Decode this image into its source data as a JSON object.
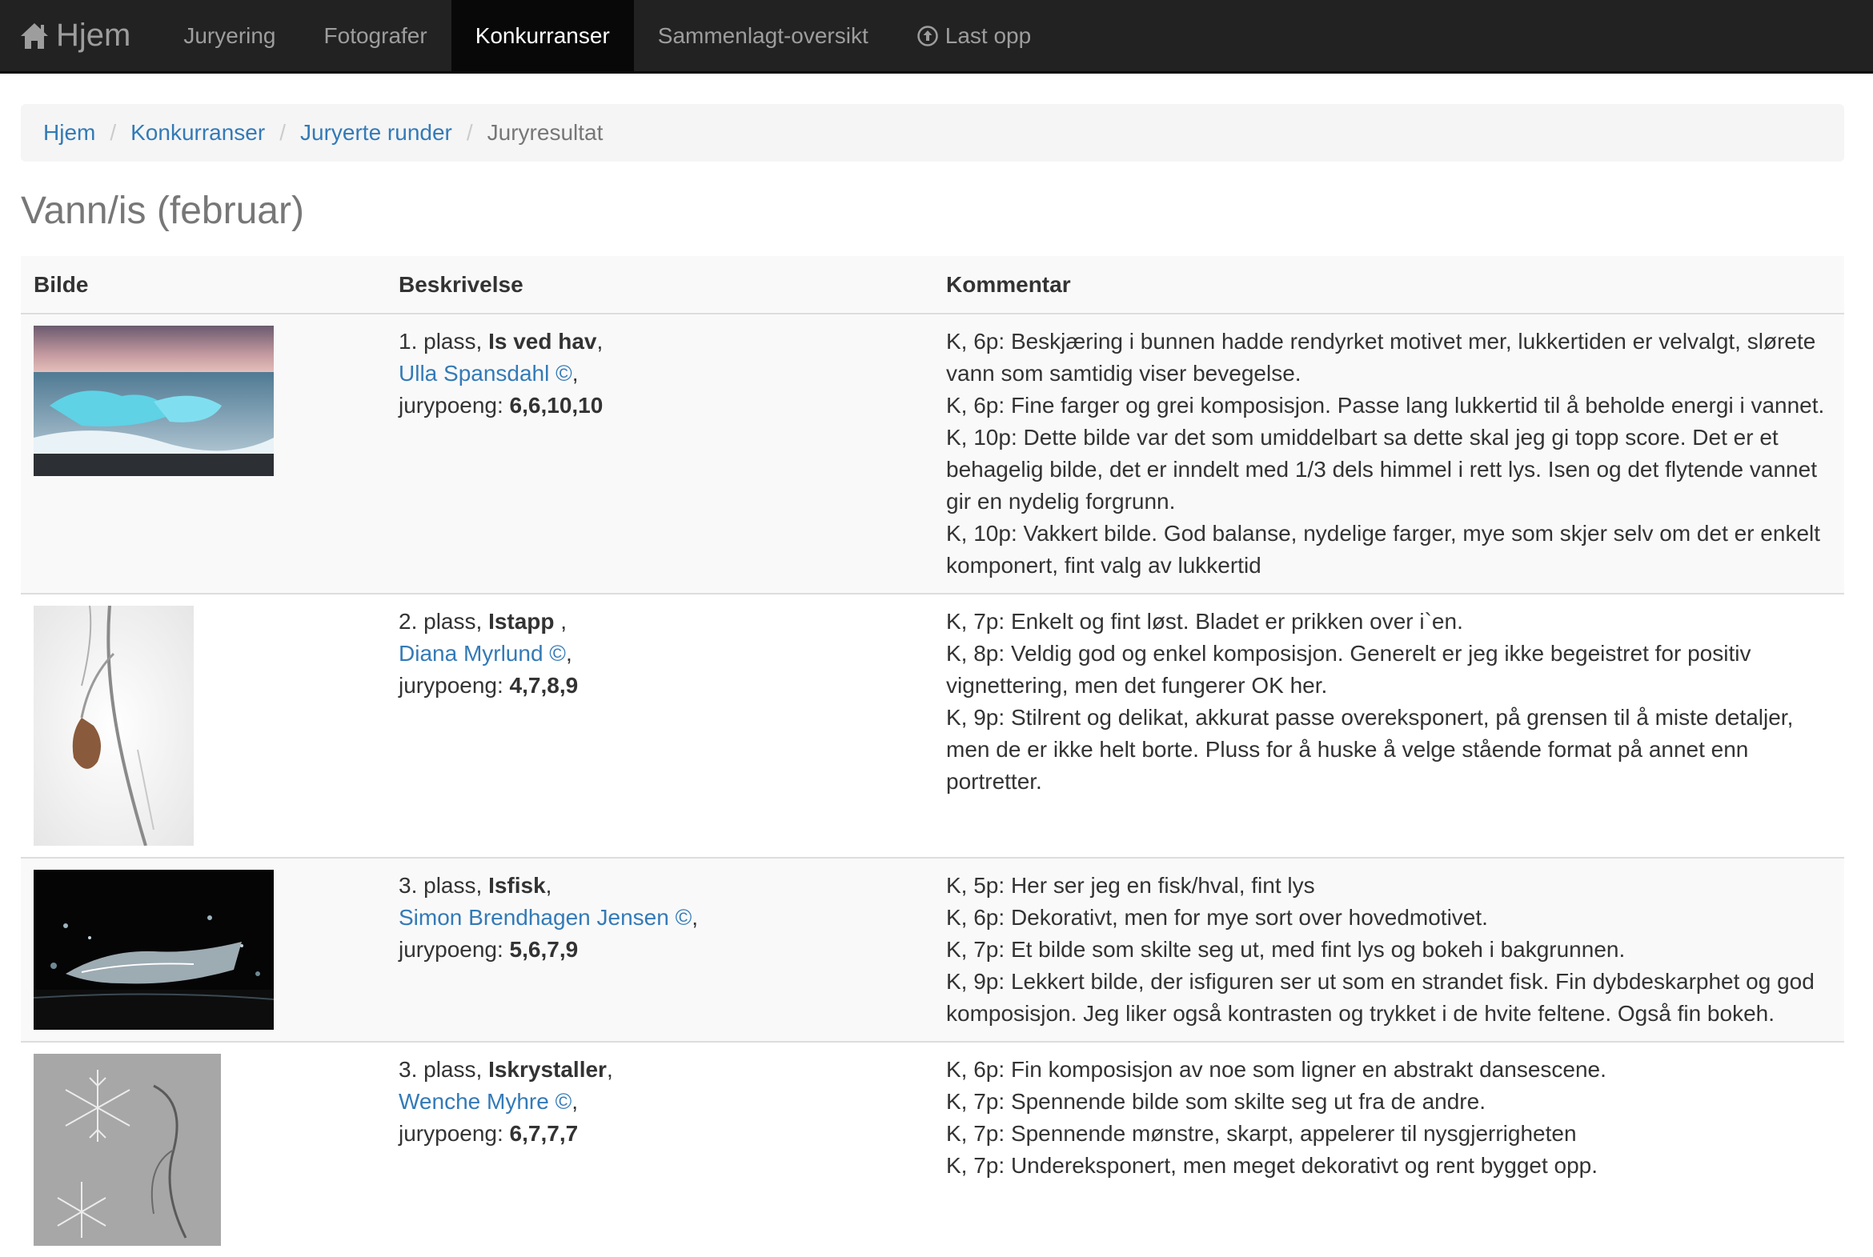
{
  "nav": {
    "brand": "Hjem",
    "items": [
      {
        "label": "Juryering",
        "active": false
      },
      {
        "label": "Fotografer",
        "active": false
      },
      {
        "label": "Konkurranser",
        "active": true
      },
      {
        "label": "Sammenlagt-oversikt",
        "active": false
      },
      {
        "label": "Last opp",
        "active": false
      }
    ]
  },
  "breadcrumb": {
    "items": [
      "Hjem",
      "Konkurranser",
      "Juryerte runder"
    ],
    "current": "Juryresultat",
    "separator": "/"
  },
  "page_title": "Vann/is (februar)",
  "table": {
    "headers": [
      "Bilde",
      "Beskrivelse",
      "Kommentar"
    ],
    "points_label": "jurypoeng:",
    "rows": [
      {
        "place": "1. plass,",
        "title": "Is ved hav",
        "title_suffix": ",",
        "photographer": "Ulla Spansdahl ©",
        "points": "6,6,10,10",
        "comments": [
          "K, 6p: Beskjæring i bunnen hadde rendyrket motivet mer, lukkertiden er velvalgt, slørete vann som samtidig viser bevegelse.",
          "K, 6p: Fine farger og grei komposisjon. Passe lang lukkertid til å beholde energi i vannet.",
          "K, 10p: Dette bilde var det som umiddelbart sa dette skal jeg gi topp score. Det er et behagelig bilde, det er inndelt med 1/3 dels himmel i rett lys. Isen og det flytende vannet gir en nydelig forgrunn.",
          "K, 10p: Vakkert bilde. God balanse, nydelige farger, mye som skjer selv om det er enkelt komponert, fint valg av lukkertid"
        ]
      },
      {
        "place": "2. plass,",
        "title": "Istapp",
        "title_suffix": " ,",
        "photographer": "Diana Myrlund ©",
        "points": "4,7,8,9",
        "comments": [
          "K, 7p: Enkelt og fint løst. Bladet er prikken over i`en.",
          "K, 8p: Veldig god og enkel komposisjon. Generelt er jeg ikke begeistret for positiv vignettering, men det fungerer OK her.",
          "K, 9p: Stilrent og delikat, akkurat passe overeksponert, på grensen til å miste detaljer, men de er ikke helt borte. Pluss for å huske å velge stående format på annet enn portretter."
        ]
      },
      {
        "place": "3. plass,",
        "title": "Isfisk",
        "title_suffix": ",",
        "photographer": "Simon Brendhagen Jensen ©",
        "points": "5,6,7,9",
        "comments": [
          "K, 5p: Her ser jeg en fisk/hval, fint lys",
          "K, 6p: Dekorativt, men for mye sort over hovedmotivet.",
          "K, 7p: Et bilde som skilte seg ut, med fint lys og bokeh i bakgrunnen.",
          "K, 9p: Lekkert bilde, der isfiguren ser ut som en strandet fisk. Fin dybdeskarphet og god komposisjon. Jeg liker også kontrasten og trykket i de hvite feltene. Også fin bokeh."
        ]
      },
      {
        "place": "3. plass,",
        "title": "Iskrystaller",
        "title_suffix": ",",
        "photographer": "Wenche Myhre ©",
        "points": "6,7,7,7",
        "comments": [
          "K, 6p: Fin komposisjon av noe som ligner en abstrakt dansescene.",
          "K, 7p: Spennende bilde som skilte seg ut fra de andre.",
          "K, 7p: Spennende mønstre, skarpt, appelerer til nysgjerrigheten",
          "K, 7p: Undereksponert, men meget dekorativt og rent bygget opp."
        ]
      }
    ]
  }
}
